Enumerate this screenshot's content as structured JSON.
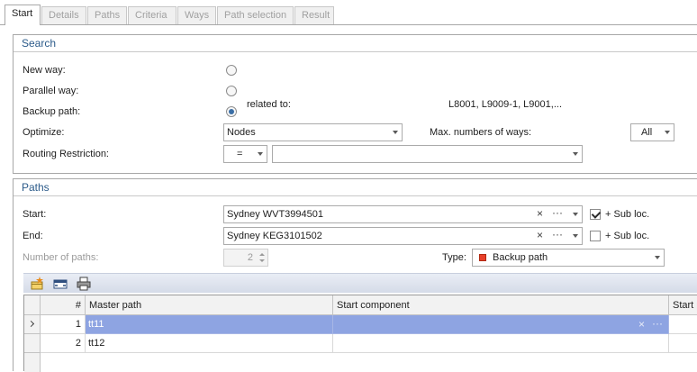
{
  "tabs": [
    {
      "label": "Start",
      "active": true
    },
    {
      "label": "Details",
      "active": false
    },
    {
      "label": "Paths",
      "active": false
    },
    {
      "label": "Criteria",
      "active": false
    },
    {
      "label": "Ways",
      "active": false
    },
    {
      "label": "Path selection",
      "active": false
    },
    {
      "label": "Result",
      "active": false
    }
  ],
  "search": {
    "title": "Search",
    "new_way_label": "New way:",
    "parallel_way_label": "Parallel way:",
    "backup_path_label": "Backup path:",
    "related_to_label": "related to:",
    "related_to_value": "L8001, L9009-1, L9001,...",
    "optimize_label": "Optimize:",
    "optimize_value": "Nodes",
    "max_ways_label": "Max. numbers of ways:",
    "max_ways_value": "All",
    "routing_label": "Routing Restriction:",
    "routing_operator": "=",
    "routing_value": "",
    "selected_mode": "backup_path"
  },
  "paths": {
    "title": "Paths",
    "start_label": "Start:",
    "start_value": "Sydney WVT3994501",
    "start_subloc_label": "+ Sub loc.",
    "start_subloc_checked": true,
    "end_label": "End:",
    "end_value": "Sydney KEG3101502",
    "end_subloc_label": "+ Sub loc.",
    "end_subloc_checked": false,
    "num_paths_label": "Number of paths:",
    "num_paths_value": "2",
    "type_label": "Type:",
    "type_value": "Backup path",
    "type_color": "#e8402a"
  },
  "grid": {
    "columns": [
      "#",
      "Master path",
      "Start component",
      "Start p"
    ],
    "rows": [
      {
        "num": "1",
        "master": "tt11",
        "start_component": "",
        "selected": true
      },
      {
        "num": "2",
        "master": "tt12",
        "start_component": "",
        "selected": false
      }
    ]
  },
  "icons": {
    "clear": "×",
    "more": "···"
  }
}
